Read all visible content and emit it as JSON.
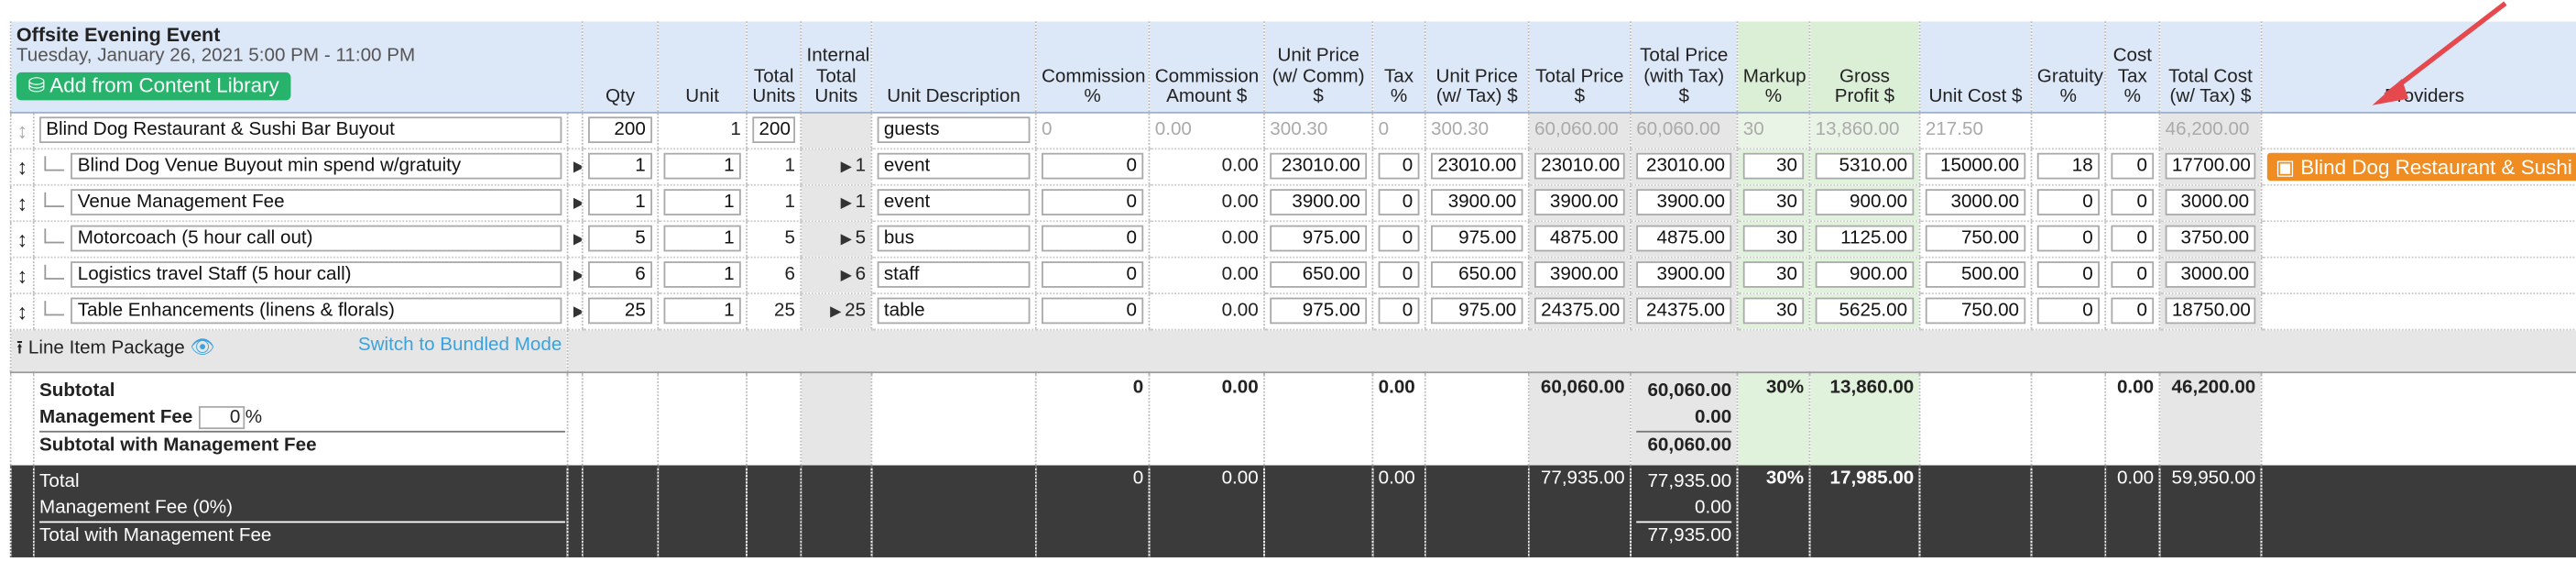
{
  "event": {
    "name": "Offsite Evening Event",
    "date": "Tuesday, January 26, 2021 5:00 PM - 11:00 PM",
    "add_button": "Add from Content Library"
  },
  "headers": {
    "qty": "Qty",
    "unit": "Unit",
    "total_units": "Total Units",
    "internal_total_units": "Internal Total Units",
    "unit_description": "Unit Description",
    "commission_pct": "Commission %",
    "commission_amount": "Commission Amount $",
    "unit_price_comm": "Unit Price (w/ Comm) $",
    "tax_pct": "Tax %",
    "unit_price_tax": "Unit Price (w/ Tax) $",
    "total_price": "Total Price $",
    "total_price_tax": "Total Price (with Tax) $",
    "markup_pct": "Markup %",
    "gross_profit": "Gross Profit $",
    "unit_cost": "Unit Cost $",
    "gratuity_pct": "Gratuity %",
    "cost_tax_pct": "Cost Tax %",
    "total_cost_tax": "Total Cost (w/ Tax) $",
    "providers": "Providers"
  },
  "package": {
    "name": "Blind Dog Restaurant & Sushi Bar Buyout",
    "qty": "200",
    "unit": "1",
    "total_units": "200",
    "unit_desc": "guests",
    "commission_pct": "0",
    "commission_amount": "0.00",
    "unit_price_comm": "300.30",
    "tax_pct": "0",
    "unit_price_tax": "300.30",
    "total_price": "60,060.00",
    "total_price_tax": "60,060.00",
    "markup": "30",
    "gross_profit": "13,860.00",
    "unit_cost": "217.50",
    "total_cost": "46,200.00"
  },
  "items": [
    {
      "name": "Blind Dog Venue Buyout min spend w/gratuity",
      "qty": "1",
      "unit": "1",
      "total_units": "1",
      "internal": "1",
      "unit_desc": "event",
      "commission_pct": "0",
      "commission_amount": "0.00",
      "unit_price_comm": "23010.00",
      "tax_pct": "0",
      "unit_price_tax": "23010.00",
      "total_price": "23010.00",
      "total_price_tax": "23010.00",
      "markup": "30",
      "gross_profit": "5310.00",
      "unit_cost": "15000.00",
      "gratuity": "18",
      "cost_tax": "0",
      "total_cost": "17700.00",
      "provider": "Blind Dog Restaurant & Sushi Bar"
    },
    {
      "name": "Venue Management Fee",
      "qty": "1",
      "unit": "1",
      "total_units": "1",
      "internal": "1",
      "unit_desc": "event",
      "commission_pct": "0",
      "commission_amount": "0.00",
      "unit_price_comm": "3900.00",
      "tax_pct": "0",
      "unit_price_tax": "3900.00",
      "total_price": "3900.00",
      "total_price_tax": "3900.00",
      "markup": "30",
      "gross_profit": "900.00",
      "unit_cost": "3000.00",
      "gratuity": "0",
      "cost_tax": "0",
      "total_cost": "3000.00",
      "provider": ""
    },
    {
      "name": "Motorcoach (5 hour call out)",
      "qty": "5",
      "unit": "1",
      "total_units": "5",
      "internal": "5",
      "unit_desc": "bus",
      "commission_pct": "0",
      "commission_amount": "0.00",
      "unit_price_comm": "975.00",
      "tax_pct": "0",
      "unit_price_tax": "975.00",
      "total_price": "4875.00",
      "total_price_tax": "4875.00",
      "markup": "30",
      "gross_profit": "1125.00",
      "unit_cost": "750.00",
      "gratuity": "0",
      "cost_tax": "0",
      "total_cost": "3750.00",
      "provider": ""
    },
    {
      "name": "Logistics travel Staff (5 hour call)",
      "qty": "6",
      "unit": "1",
      "total_units": "6",
      "internal": "6",
      "unit_desc": "staff",
      "commission_pct": "0",
      "commission_amount": "0.00",
      "unit_price_comm": "650.00",
      "tax_pct": "0",
      "unit_price_tax": "650.00",
      "total_price": "3900.00",
      "total_price_tax": "3900.00",
      "markup": "30",
      "gross_profit": "900.00",
      "unit_cost": "500.00",
      "gratuity": "0",
      "cost_tax": "0",
      "total_cost": "3000.00",
      "provider": ""
    },
    {
      "name": "Table Enhancements (linens & florals)",
      "qty": "25",
      "unit": "1",
      "total_units": "25",
      "internal": "25",
      "unit_desc": "table",
      "commission_pct": "0",
      "commission_amount": "0.00",
      "unit_price_comm": "975.00",
      "tax_pct": "0",
      "unit_price_tax": "975.00",
      "total_price": "24375.00",
      "total_price_tax": "24375.00",
      "markup": "30",
      "gross_profit": "5625.00",
      "unit_cost": "750.00",
      "gratuity": "0",
      "cost_tax": "0",
      "total_cost": "18750.00",
      "provider": ""
    }
  ],
  "package_row": {
    "label": "Line Item Package",
    "switch_link": "Switch to Bundled Mode"
  },
  "subtotal": {
    "label": "Subtotal",
    "mgmt_fee_label": "Management Fee",
    "mgmt_fee_value": "0",
    "pct_sign": "%",
    "with_fee_label": "Subtotal with Management Fee",
    "commission_pct": "0",
    "commission_amount": "0.00",
    "tax": "0.00",
    "total_price": "60,060.00",
    "total_price_tax": "60,060.00",
    "fee_amount": "0.00",
    "with_fee_total": "60,060.00",
    "markup": "30%",
    "gross_profit": "13,860.00",
    "cost_tax": "0.00",
    "total_cost": "46,200.00"
  },
  "total": {
    "label": "Total",
    "mgmt_fee_label": "Management Fee (0%)",
    "with_fee_label": "Total with Management Fee",
    "commission_pct": "0",
    "commission_amount": "0.00",
    "tax": "0.00",
    "total_price": "77,935.00",
    "total_price_tax": "77,935.00",
    "fee_amount": "0.00",
    "with_fee_total": "77,935.00",
    "markup": "30%",
    "gross_profit": "17,985.00",
    "cost_tax": "0.00",
    "total_cost": "59,950.00"
  },
  "colors": {
    "header_bg": "#dce7f7",
    "margin_bg": "#e1f2dc",
    "total_bg": "#3b3b3b",
    "provider_btn": "#ef8c22",
    "add_btn": "#27b36b",
    "arrow": "#e5484d"
  },
  "icons": {
    "row_handle": "drag-handle-icon",
    "expand": "expand-arrow-icon",
    "database": "database-icon",
    "calendar": "calendar-icon",
    "upload": "upload-icon",
    "eye": "eye-icon"
  }
}
